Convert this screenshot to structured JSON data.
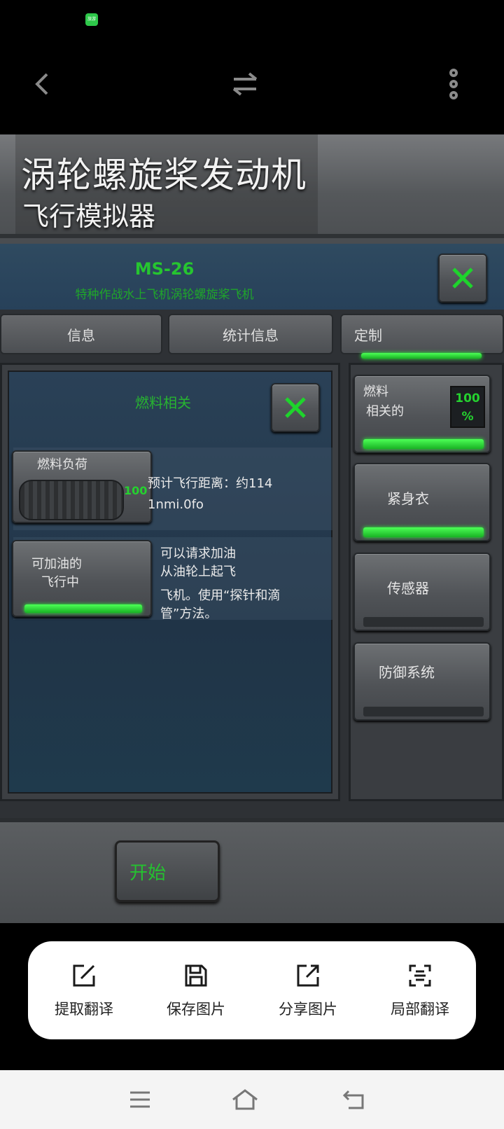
{
  "status": {
    "app_badge": "旅游"
  },
  "topbar": {
    "back": "back-icon",
    "swap": "swap-icon",
    "more": "more-icon"
  },
  "game": {
    "title_main": "涡轮螺旋桨发动机",
    "title_sub": "飞行模拟器",
    "model_code": "MS-26",
    "model_desc": "特种作战水上飞机涡轮螺旋桨飞机",
    "tabs": [
      "信息",
      "统计信息",
      "定制"
    ],
    "section_title": "燃料相关",
    "fuel_load": {
      "label": "燃料负荷",
      "percent": "100",
      "range_text_1": "预计飞行距离：约114",
      "range_text_2": "1nmi.0fo"
    },
    "refuel": {
      "label_1": "可加油的",
      "label_2": "飞行中",
      "desc_1": "可以请求加油",
      "desc_2": "从油轮上起飞",
      "desc_3": "飞机。使用“探针和滴",
      "desc_4": "管”方法。"
    },
    "side_items": {
      "fuel_1": "燃料",
      "fuel_2": "相关的",
      "fuel_pct_1": "100",
      "fuel_pct_2": "%",
      "suit": "紧身衣",
      "sensor": "传感器",
      "defense": "防御系统"
    },
    "start_label": "开始",
    "accent_green": "#25c130"
  },
  "actions": [
    {
      "label": "提取翻译",
      "icon": "edit-icon"
    },
    {
      "label": "保存图片",
      "icon": "save-icon"
    },
    {
      "label": "分享图片",
      "icon": "share-icon"
    },
    {
      "label": "局部翻译",
      "icon": "scan-icon"
    }
  ],
  "navbar": {
    "menu": "menu-icon",
    "home": "home-icon",
    "back": "return-icon"
  }
}
